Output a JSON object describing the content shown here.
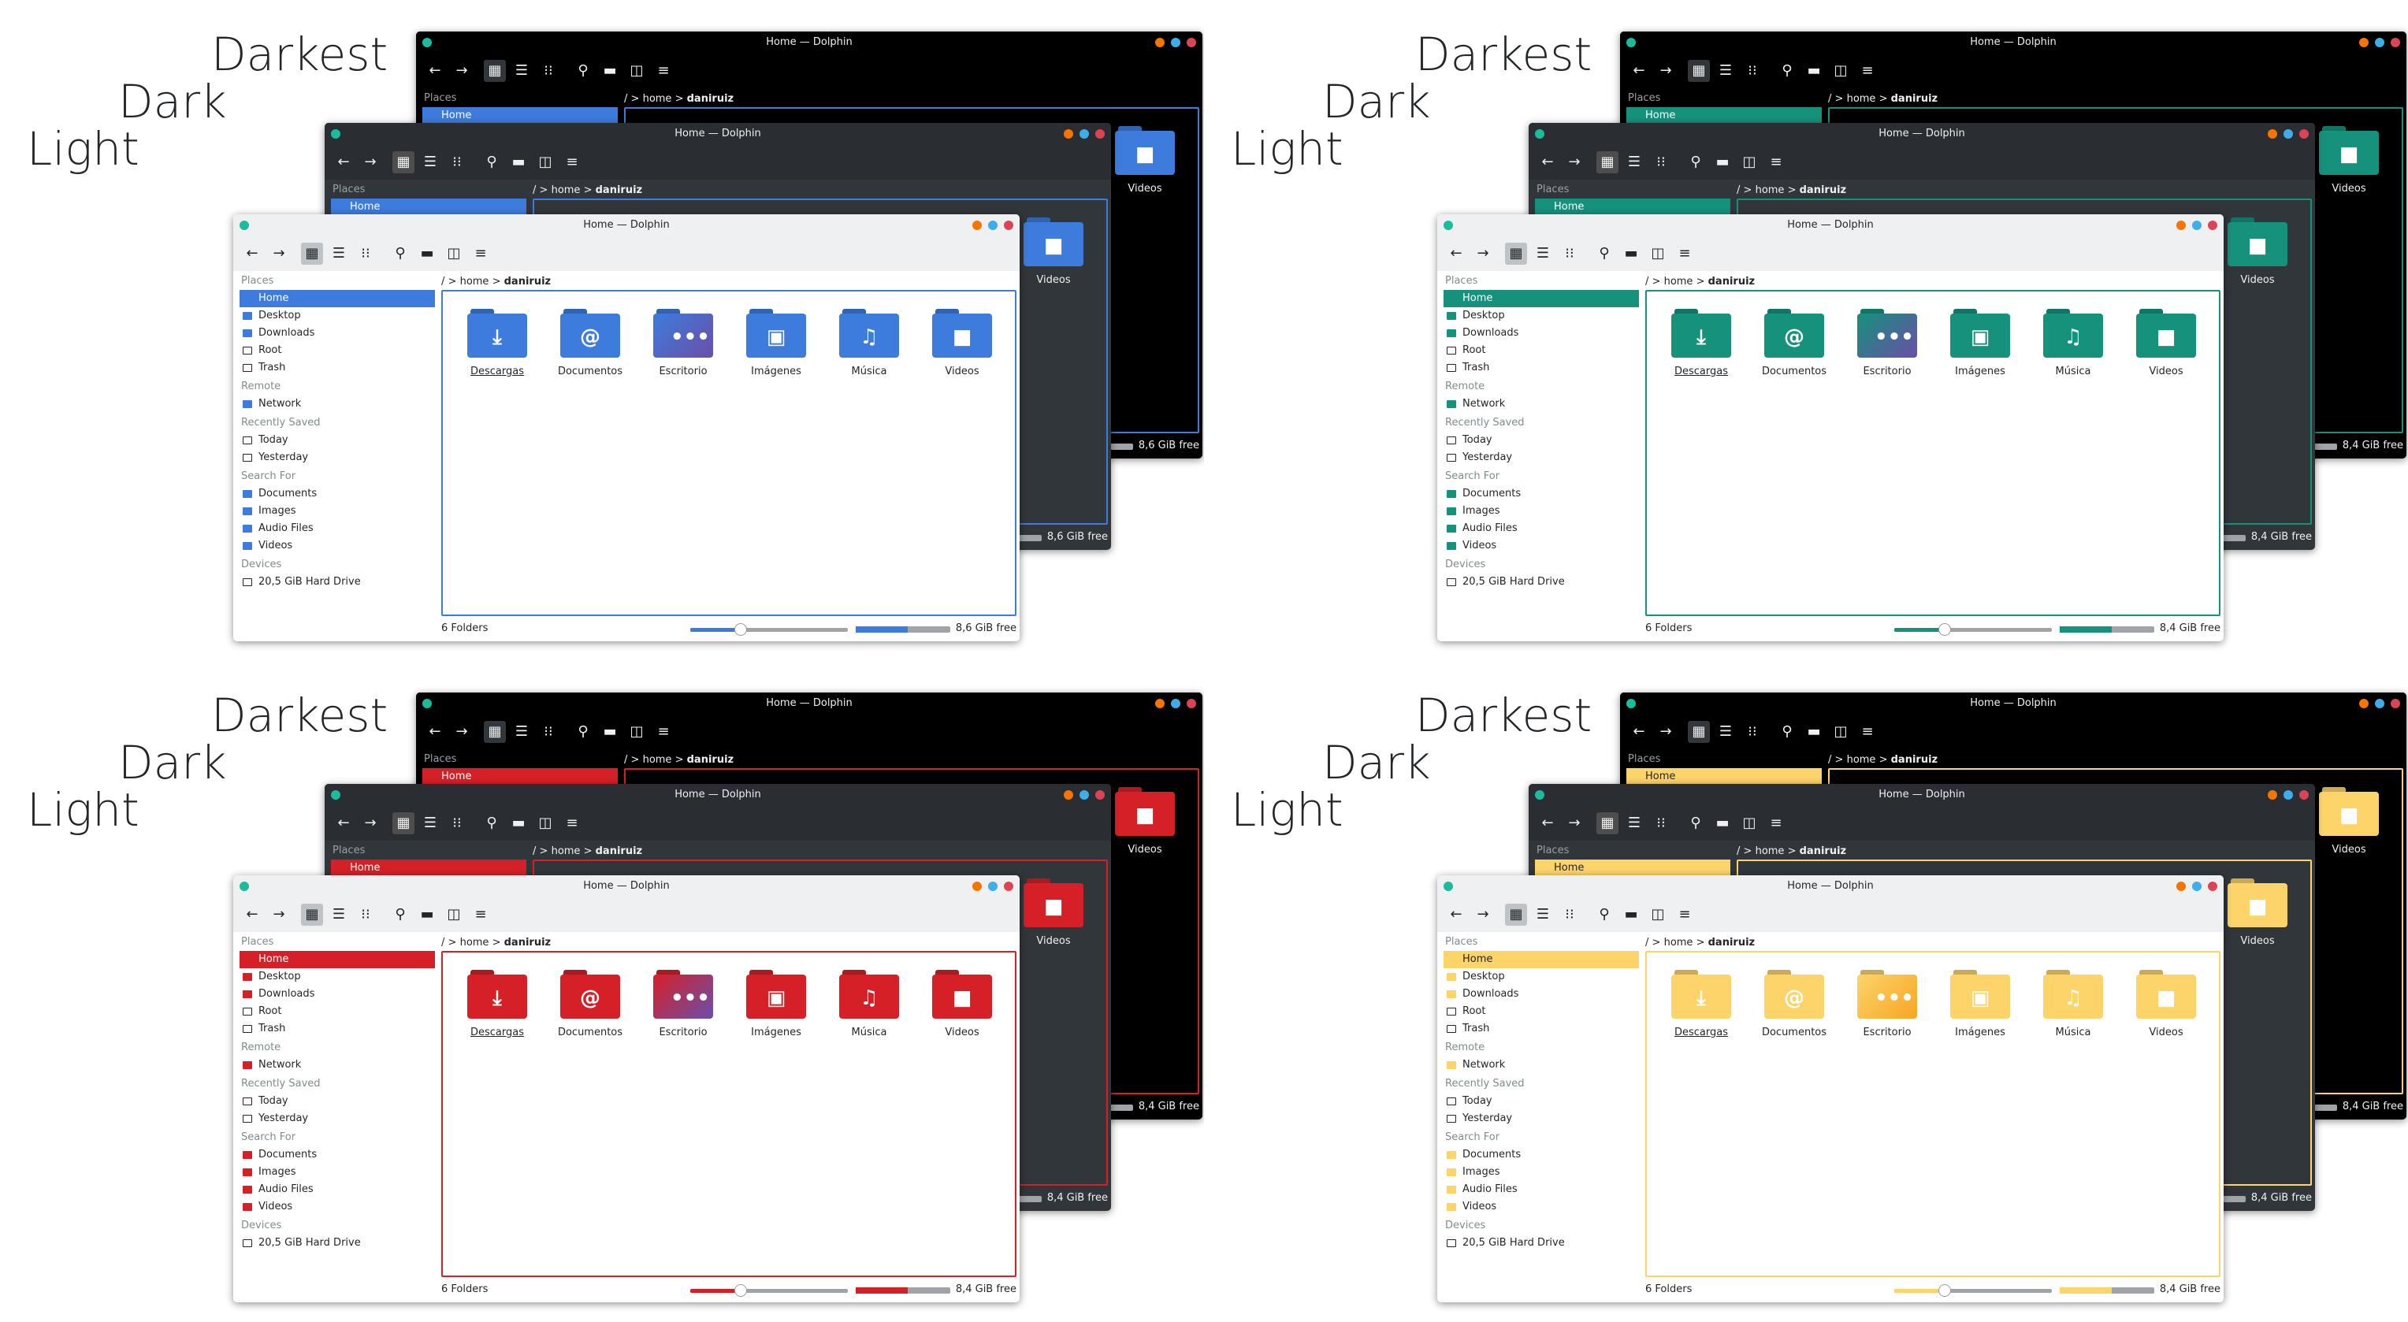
{
  "window_title": "Home — Dolphin",
  "variants": [
    "Darkest",
    "Dark",
    "Light"
  ],
  "icons": {
    "back": "arrow-left-icon",
    "forward": "arrow-right-icon",
    "view_icons": "icons-view-icon",
    "view_compact": "compact-view-icon",
    "view_details": "details-view-icon",
    "search": "search-icon",
    "preview": "preview-icon",
    "split": "split-view-icon",
    "menu": "hamburger-menu-icon"
  },
  "breadcrumb": {
    "root": "/",
    "sep": ">",
    "home": "home",
    "user": "daniruiz"
  },
  "sidebar": {
    "places_label": "Places",
    "places": [
      "Home",
      "Desktop",
      "Downloads",
      "Root",
      "Trash"
    ],
    "remote_label": "Remote",
    "remote": [
      "Network"
    ],
    "recent_label": "Recently Saved",
    "recent": [
      "Today",
      "Yesterday"
    ],
    "search_label": "Search For",
    "search": [
      "Documents",
      "Images",
      "Audio Files",
      "Videos"
    ],
    "devices_label": "Devices",
    "devices": [
      "20,5 GiB Hard Drive"
    ]
  },
  "folders": [
    {
      "name": "Descargas",
      "glyph": "⤓"
    },
    {
      "name": "Documentos",
      "glyph": "@"
    },
    {
      "name": "Escritorio",
      "glyph": "•••"
    },
    {
      "name": "Imágenes",
      "glyph": "▣"
    },
    {
      "name": "Música",
      "glyph": "♫"
    },
    {
      "name": "Videos",
      "glyph": "■"
    }
  ],
  "status": {
    "count": "6 Folders"
  },
  "themes": [
    {
      "id": "blue",
      "accent": "#3d7cdd",
      "free_darkest": "8,6 GiB free",
      "free_dark": "8,6 GiB free",
      "free_light": "8,6 GiB free"
    },
    {
      "id": "teal",
      "accent": "#16917c",
      "free_darkest": "8,4 GiB free",
      "free_dark": "8,4 GiB free",
      "free_light": "8,4 GiB free"
    },
    {
      "id": "red",
      "accent": "#d62027",
      "free_darkest": "8,4 GiB free",
      "free_dark": "8,4 GiB free",
      "free_light": "8,4 GiB free"
    },
    {
      "id": "yellow",
      "accent": "#fdd46a",
      "free_darkest": "8,4 GiB free",
      "free_dark": "8,4 GiB free",
      "free_light": "8,4 GiB free"
    }
  ]
}
